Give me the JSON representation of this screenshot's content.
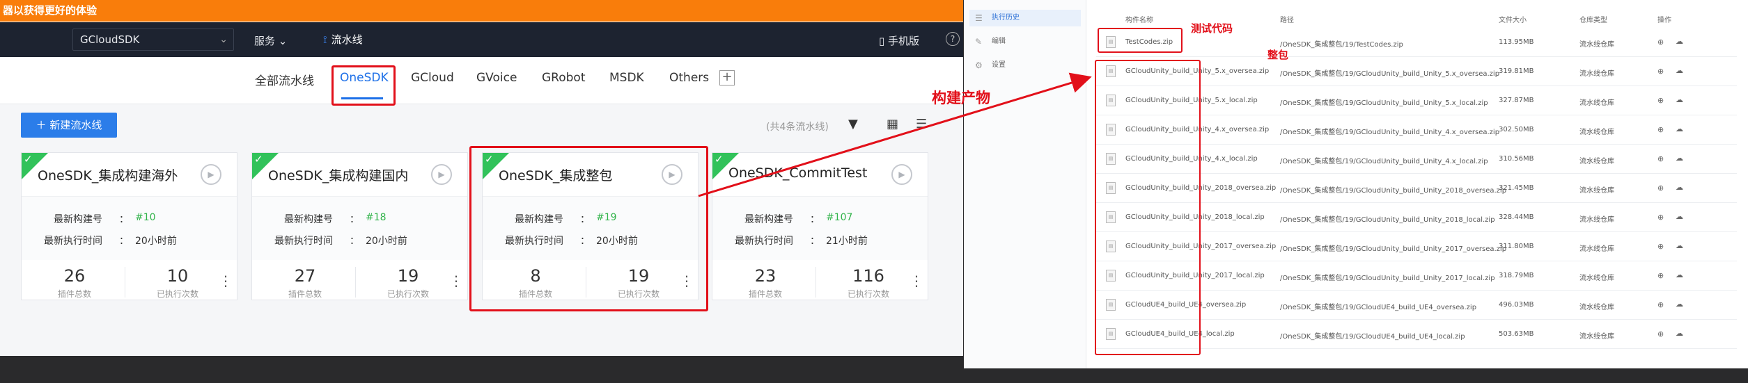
{
  "banner": {
    "text": "器以获得更好的体验"
  },
  "topnav": {
    "project": "GCloudSDK",
    "service": "服务",
    "pipeline": "流水线",
    "mobile": "手机版",
    "help": "?"
  },
  "tabs": [
    "全部流水线",
    "OneSDK",
    "GCloud",
    "GVoice",
    "GRobot",
    "MSDK",
    "Others"
  ],
  "toolbar": {
    "new_pipeline": "新建流水线",
    "count_text": "(共4条流水线)"
  },
  "card_labels": {
    "build_no": "最新构建号",
    "exec_time": "最新执行时间",
    "plugins": "插件总数",
    "executions": "已执行次数",
    "sep": "："
  },
  "cards": [
    {
      "title": "OneSDK_集成构建海外",
      "build": "#10",
      "time": "20小时前",
      "plugins": "26",
      "executions": "10"
    },
    {
      "title": "OneSDK_集成构建国内",
      "build": "#18",
      "time": "20小时前",
      "plugins": "27",
      "executions": "19"
    },
    {
      "title": "OneSDK_集成整包",
      "build": "#19",
      "time": "20小时前",
      "plugins": "8",
      "executions": "19"
    },
    {
      "title": "OneSDK_CommitTest",
      "build": "#107",
      "time": "21小时前",
      "plugins": "23",
      "executions": "116"
    }
  ],
  "sidebar": [
    "执行历史",
    "编辑",
    "设置"
  ],
  "table": {
    "headers": [
      "构件名称",
      "路径",
      "文件大小",
      "仓库类型",
      "操作"
    ],
    "rows": [
      {
        "name": "TestCodes.zip",
        "path": "/OneSDK_集成整包/19/TestCodes.zip",
        "size": "113.95MB",
        "repo": "流水线仓库"
      },
      {
        "name": "GCloudUnity_build_Unity_5.x_oversea.zip",
        "path": "/OneSDK_集成整包/19/GCloudUnity_build_Unity_5.x_oversea.zip",
        "size": "319.81MB",
        "repo": "流水线仓库"
      },
      {
        "name": "GCloudUnity_build_Unity_5.x_local.zip",
        "path": "/OneSDK_集成整包/19/GCloudUnity_build_Unity_5.x_local.zip",
        "size": "327.87MB",
        "repo": "流水线仓库"
      },
      {
        "name": "GCloudUnity_build_Unity_4.x_oversea.zip",
        "path": "/OneSDK_集成整包/19/GCloudUnity_build_Unity_4.x_oversea.zip",
        "size": "302.50MB",
        "repo": "流水线仓库"
      },
      {
        "name": "GCloudUnity_build_Unity_4.x_local.zip",
        "path": "/OneSDK_集成整包/19/GCloudUnity_build_Unity_4.x_local.zip",
        "size": "310.56MB",
        "repo": "流水线仓库"
      },
      {
        "name": "GCloudUnity_build_Unity_2018_oversea.zip",
        "path": "/OneSDK_集成整包/19/GCloudUnity_build_Unity_2018_oversea.zip",
        "size": "321.45MB",
        "repo": "流水线仓库"
      },
      {
        "name": "GCloudUnity_build_Unity_2018_local.zip",
        "path": "/OneSDK_集成整包/19/GCloudUnity_build_Unity_2018_local.zip",
        "size": "328.44MB",
        "repo": "流水线仓库"
      },
      {
        "name": "GCloudUnity_build_Unity_2017_oversea.zip",
        "path": "/OneSDK_集成整包/19/GCloudUnity_build_Unity_2017_oversea.zip",
        "size": "311.80MB",
        "repo": "流水线仓库"
      },
      {
        "name": "GCloudUnity_build_Unity_2017_local.zip",
        "path": "/OneSDK_集成整包/19/GCloudUnity_build_Unity_2017_local.zip",
        "size": "318.79MB",
        "repo": "流水线仓库"
      },
      {
        "name": "GCloudUE4_build_UE4_oversea.zip",
        "path": "/OneSDK_集成整包/19/GCloudUE4_build_UE4_oversea.zip",
        "size": "496.03MB",
        "repo": "流水线仓库"
      },
      {
        "name": "GCloudUE4_build_UE4_local.zip",
        "path": "/OneSDK_集成整包/19/GCloudUE4_build_UE4_local.zip",
        "size": "503.63MB",
        "repo": "流水线仓库"
      }
    ]
  },
  "annotations": {
    "build_artifacts": "构建产物",
    "test_code": "测试代码",
    "full_package": "整包"
  },
  "colors": {
    "accent": "#1c6fe8",
    "banner": "#f97d0b",
    "annotation": "#e2101a",
    "success": "#31c25a"
  }
}
